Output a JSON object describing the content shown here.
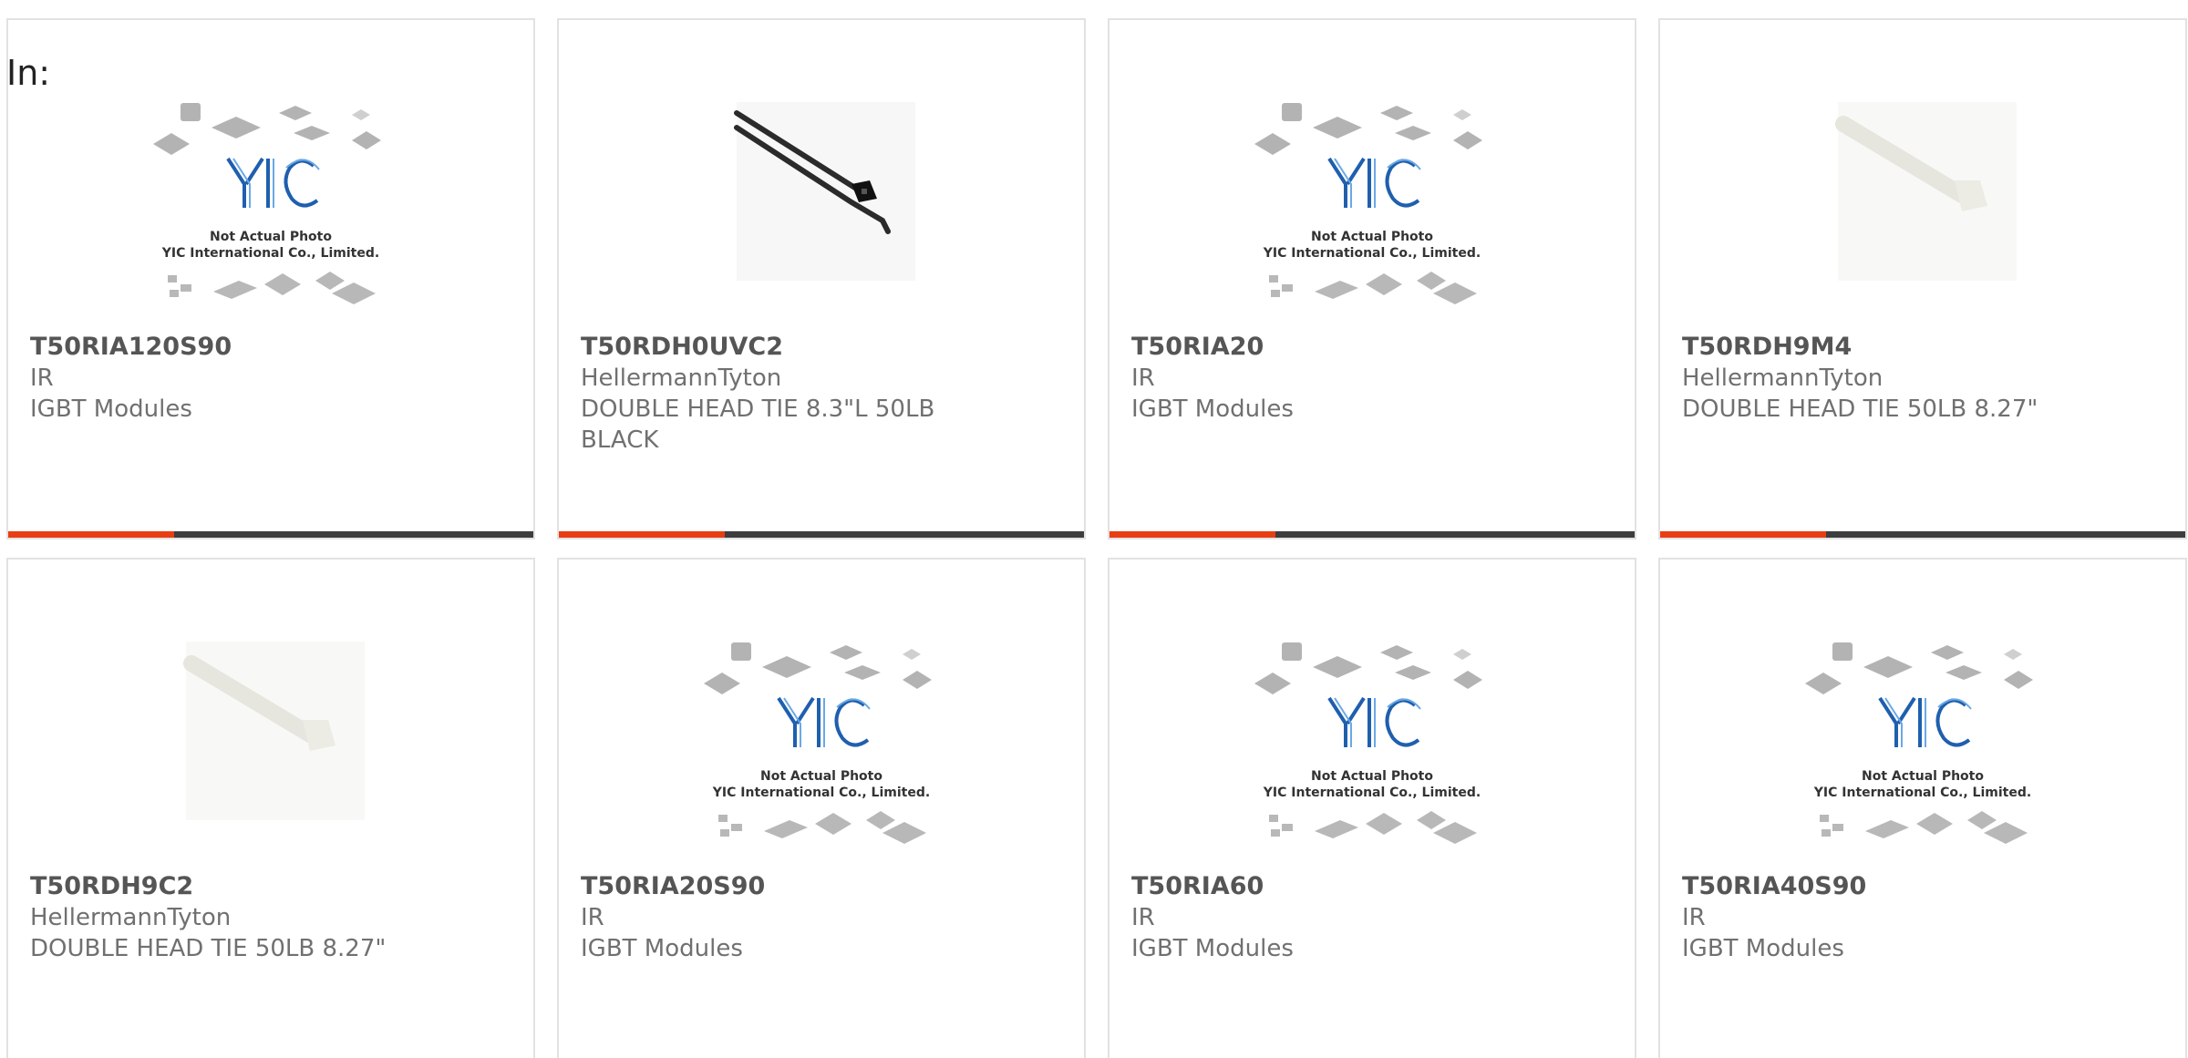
{
  "header": {
    "prefix": "In:"
  },
  "placeholder": {
    "line1": "Not Actual Photo",
    "line2": "YIC International Co., Limited.",
    "logo": "YIC"
  },
  "colors": {
    "accent": "#e83e14",
    "bar": "#3d3d3d",
    "border": "#e2e2e2"
  },
  "products": [
    {
      "part": "T50RIA120S90",
      "maker": "IR",
      "desc": "IGBT Modules",
      "image": "placeholder"
    },
    {
      "part": "T50RDH0UVC2",
      "maker": "HellermannTyton",
      "desc": "DOUBLE HEAD TIE 8.3\"L 50LB BLACK",
      "image": "black-cable-tie"
    },
    {
      "part": "T50RIA20",
      "maker": "IR",
      "desc": "IGBT Modules",
      "image": "placeholder"
    },
    {
      "part": "T50RDH9M4",
      "maker": "HellermannTyton",
      "desc": "DOUBLE HEAD TIE 50LB 8.27\"",
      "image": "natural-cable-tie"
    },
    {
      "part": "T50RDH9C2",
      "maker": "HellermannTyton",
      "desc": "DOUBLE HEAD TIE 50LB 8.27\"",
      "image": "natural-cable-tie"
    },
    {
      "part": "T50RIA20S90",
      "maker": "IR",
      "desc": "IGBT Modules",
      "image": "placeholder"
    },
    {
      "part": "T50RIA60",
      "maker": "IR",
      "desc": "IGBT Modules",
      "image": "placeholder"
    },
    {
      "part": "T50RIA40S90",
      "maker": "IR",
      "desc": "IGBT Modules",
      "image": "placeholder"
    }
  ]
}
